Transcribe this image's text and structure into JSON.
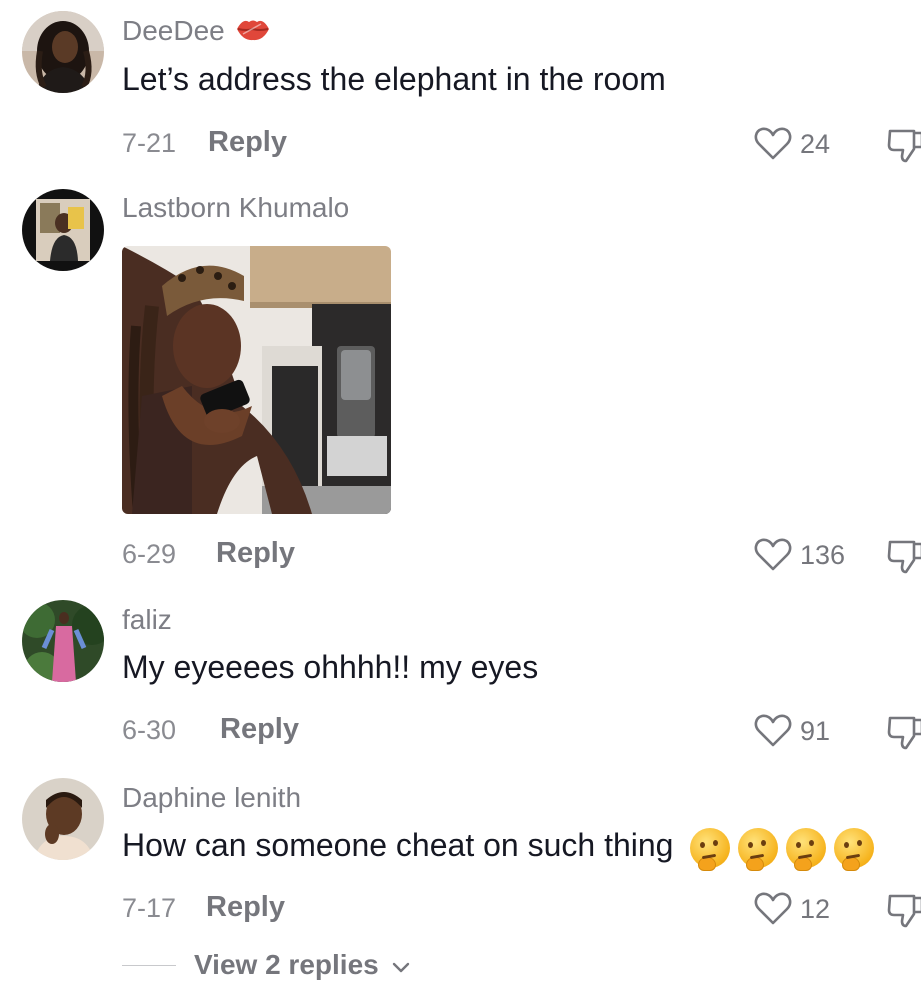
{
  "comments": [
    {
      "username": "DeeDee",
      "username_suffix_icon": "lips-icon",
      "text": "Let’s address the elephant in the room",
      "date": "7-21",
      "reply_label": "Reply",
      "likes": "24"
    },
    {
      "username": "Lastborn Khumalo",
      "text": "",
      "attachment": "photo",
      "date": "6-29",
      "reply_label": "Reply",
      "likes": "136"
    },
    {
      "username": "faliz",
      "text": "My eyeeees ohhhh!! my eyes",
      "date": "6-30",
      "reply_label": "Reply",
      "likes": "91"
    },
    {
      "username": "Daphine lenith",
      "text": "How can someone cheat on such thing",
      "text_emojis": [
        "thinking-face-emoji",
        "thinking-face-emoji",
        "thinking-face-emoji",
        "thinking-face-emoji"
      ],
      "date": "7-17",
      "reply_label": "Reply",
      "likes": "12"
    }
  ],
  "view_replies": {
    "label": "View 2 replies"
  },
  "colors": {
    "text_primary": "#161823",
    "text_secondary": "#7d7e85"
  }
}
